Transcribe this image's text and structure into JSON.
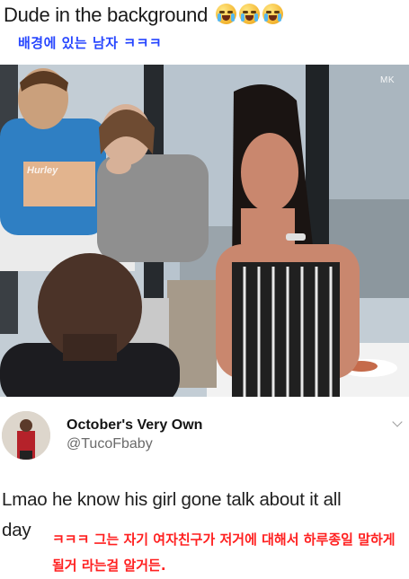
{
  "post": {
    "title": "Dude in the background",
    "title_emojis": [
      "loudly-crying-face-icon",
      "loudly-crying-face-icon",
      "loudly-crying-face-icon"
    ],
    "korean_caption": "배경에 있는 남자 ㅋㅋㅋ",
    "korean_caption_color": "#2746ff"
  },
  "photo": {
    "watermark": "MK",
    "shirt_text": "Hurley"
  },
  "tweet": {
    "display_name": "October's Very Own",
    "handle": "@TucoFbaby",
    "text_line1": "Lmao he know his girl gone talk about it all",
    "text_line2": "day",
    "korean_translation": "ㅋㅋㅋ 그는 자기 여자친구가 저거에 대해서 하루종일 말하게 될거 라는걸 알거든.",
    "korean_translation_color": "#ff2020"
  }
}
